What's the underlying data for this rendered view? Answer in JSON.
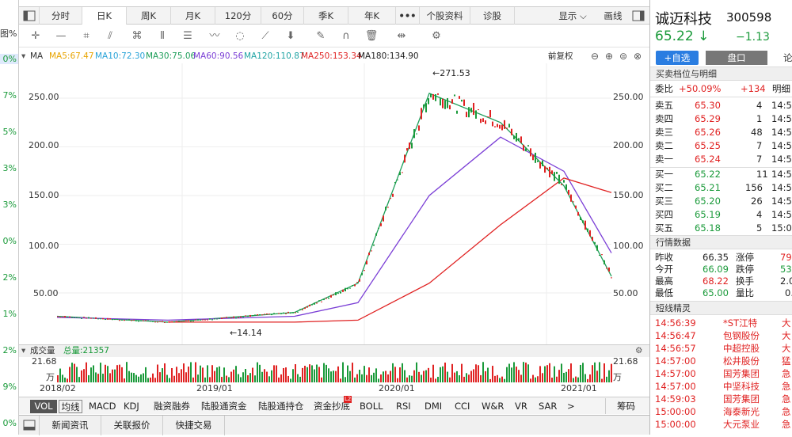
{
  "left_column": [
    "图%",
    "0%",
    "7%",
    "5%",
    "3%",
    "3%",
    "0%",
    "2%",
    "1%",
    "2%",
    "9%",
    "0%"
  ],
  "toolbar": {
    "tabs": [
      "分时",
      "日K",
      "周K",
      "月K",
      "120分",
      "60分",
      "季K",
      "年K",
      "•••",
      "个股资料",
      "诊股"
    ],
    "active": "日K",
    "display": "显示",
    "draw": "画线"
  },
  "ma_legend": {
    "label": "MA",
    "items": [
      {
        "text": "MA5:67.47",
        "color": "#e8a400"
      },
      {
        "text": "MA10:72.30",
        "color": "#29a3d8"
      },
      {
        "text": "MA30:75.06",
        "color": "#1e9e5a"
      },
      {
        "text": "MA60:90.56",
        "color": "#7b3fd6"
      },
      {
        "text": "MA120:110.87",
        "color": "#20a4a4"
      },
      {
        "text": "MA250:153.34",
        "color": "#e02222"
      },
      {
        "text": "MA180:134.90",
        "color": "#222222"
      }
    ],
    "adjust": "前复权"
  },
  "price_axis": {
    "left": [
      "250.00",
      "200.00",
      "150.00",
      "100.00",
      "50.00"
    ],
    "right": [
      "250.00",
      "200.00",
      "150.00",
      "100.00",
      "50.00"
    ],
    "high_mark": "271.53",
    "low_mark": "14.14"
  },
  "volume": {
    "label": "成交量",
    "total": "总量:21357",
    "max_left": "21.68",
    "max_right": "21.68",
    "unit_left": "万",
    "unit_right": "万"
  },
  "x_axis": [
    "2018/02",
    "2019/01",
    "2020/01",
    "2021/01"
  ],
  "indicator_tabs": [
    "VOL",
    "均线",
    "MACD",
    "KDJ",
    "融资融券",
    "陆股通资金",
    "陆股通持仓",
    "资金抄底",
    "BOLL",
    "RSI",
    "DMI",
    "CCI",
    "W&R",
    "VR",
    "SAR",
    ">"
  ],
  "indicator_active": "VOL",
  "indicator_extra": "筹码",
  "indicator_badge": "L2",
  "bottom_tabs": [
    "新闻资讯",
    "关联报价",
    "快捷交易"
  ],
  "stock": {
    "name": "诚迈科技",
    "code": "300598",
    "price": "65.22",
    "arrow": "↓",
    "change": "−1.13",
    "add_watch": "+自选",
    "tab_book": "盘口",
    "tab_more": "论"
  },
  "order_book": {
    "title": "买卖档位与明细",
    "ratio_label": "委比",
    "ratio_value": "+50.09%",
    "ratio_diff": "+134",
    "detail_label": "明细",
    "asks": [
      {
        "label": "卖五",
        "price": "65.30",
        "vol": "4",
        "time": "14:5"
      },
      {
        "label": "卖四",
        "price": "65.29",
        "vol": "1",
        "time": "14:5"
      },
      {
        "label": "卖三",
        "price": "65.26",
        "vol": "48",
        "time": "14:5"
      },
      {
        "label": "卖二",
        "price": "65.25",
        "vol": "7",
        "time": "14:5"
      },
      {
        "label": "卖一",
        "price": "65.24",
        "vol": "7",
        "time": "14:5"
      }
    ],
    "bids": [
      {
        "label": "买一",
        "price": "65.22",
        "vol": "11",
        "time": "14:5"
      },
      {
        "label": "买二",
        "price": "65.21",
        "vol": "156",
        "time": "14:5"
      },
      {
        "label": "买三",
        "price": "65.20",
        "vol": "26",
        "time": "14:5"
      },
      {
        "label": "买四",
        "price": "65.19",
        "vol": "4",
        "time": "14:5"
      },
      {
        "label": "买五",
        "price": "65.18",
        "vol": "5",
        "time": "15:0"
      }
    ]
  },
  "quote": {
    "title": "行情数据",
    "rows": [
      {
        "l1": "昨收",
        "v1": "66.35",
        "l2": "涨停",
        "v2": "79."
      },
      {
        "l1": "今开",
        "v1": "66.09",
        "l2": "跌停",
        "v2": "53."
      },
      {
        "l1": "最高",
        "v1": "68.22",
        "l2": "换手",
        "v2": "2.0"
      },
      {
        "l1": "最低",
        "v1": "65.00",
        "l2": "量比",
        "v2": "0."
      }
    ]
  },
  "short_term": {
    "title": "短线精灵",
    "rows": [
      {
        "time": "14:56:39",
        "name": "*ST江特",
        "tag": "大"
      },
      {
        "time": "14:56:47",
        "name": "包钢股份",
        "tag": "大"
      },
      {
        "time": "14:56:57",
        "name": "中超控股",
        "tag": "大"
      },
      {
        "time": "14:57:00",
        "name": "松井股份",
        "tag": "猛"
      },
      {
        "time": "14:57:00",
        "name": "国芳集团",
        "tag": "急"
      },
      {
        "time": "14:57:00",
        "name": "中坚科技",
        "tag": "急"
      },
      {
        "time": "14:59:03",
        "name": "国芳集团",
        "tag": "急"
      },
      {
        "time": "15:00:00",
        "name": "海泰新光",
        "tag": "急"
      },
      {
        "time": "15:00:00",
        "name": "大元泵业",
        "tag": "急"
      }
    ]
  },
  "chart_data": {
    "type": "line",
    "title": "",
    "x": [
      "2018/02",
      "2019/01",
      "2020/01",
      "2021/01"
    ],
    "ylim": [
      10,
      280
    ],
    "series": [
      {
        "name": "MA5",
        "values": [
          26,
          20,
          30,
          60,
          255,
          225,
          160,
          67
        ]
      },
      {
        "name": "MA60",
        "values": [
          25,
          22,
          26,
          40,
          150,
          210,
          175,
          91
        ]
      },
      {
        "name": "MA250",
        "values": [
          null,
          20,
          20,
          22,
          60,
          120,
          168,
          153
        ]
      }
    ]
  }
}
